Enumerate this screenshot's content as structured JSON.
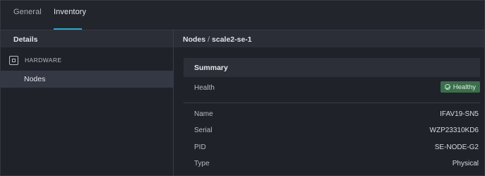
{
  "tabs": [
    {
      "label": "General"
    },
    {
      "label": "Inventory"
    }
  ],
  "left_panel": {
    "title": "Details",
    "section_label": "HARDWARE",
    "items": [
      {
        "label": "Nodes"
      }
    ]
  },
  "breadcrumb": {
    "parent": "Nodes",
    "separator": "/",
    "current": "scale2-se-1"
  },
  "summary": {
    "title": "Summary",
    "health_label": "Health",
    "health_value": "Healthy",
    "rows": [
      {
        "label": "Name",
        "value": "IFAV19-SN5"
      },
      {
        "label": "Serial",
        "value": "WZP23310KD6"
      },
      {
        "label": "PID",
        "value": "SE-NODE-G2"
      },
      {
        "label": "Type",
        "value": "Physical"
      }
    ]
  },
  "colors": {
    "accent": "#2fa7c9",
    "healthy_badge": "#3c6d4d",
    "background": "#1f2229"
  }
}
